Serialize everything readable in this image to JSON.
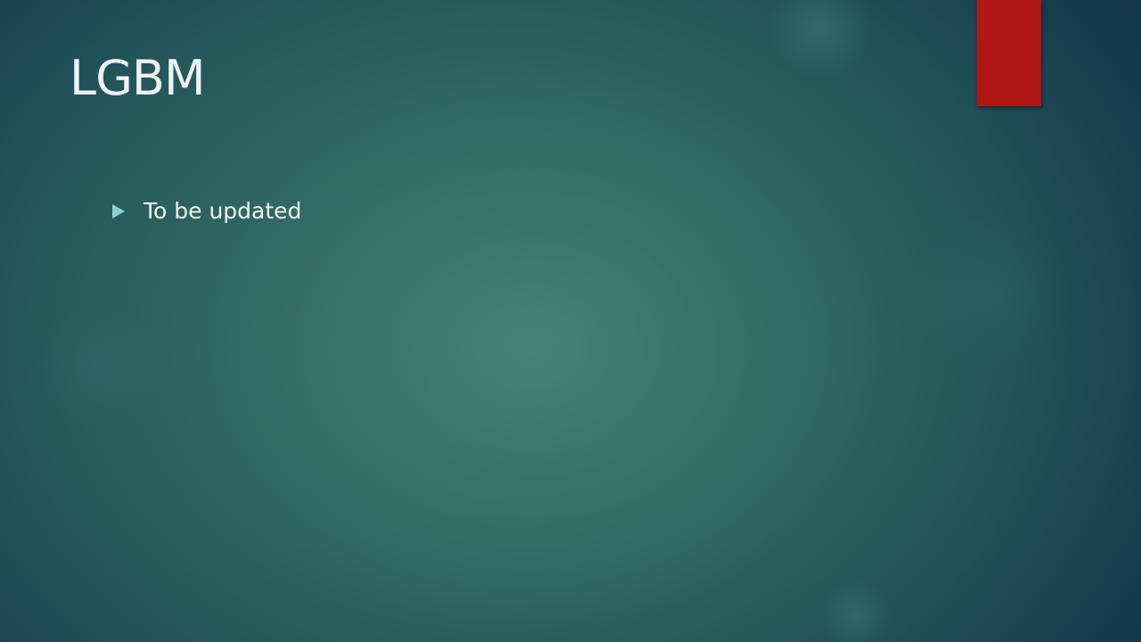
{
  "slide": {
    "title": "LGBM",
    "bullets": [
      {
        "text": "To be updated",
        "icon": "triangle-bullet-icon"
      }
    ]
  },
  "colors": {
    "accent": "#b01613",
    "bullet": "#8fd0d6",
    "text": "#f2f6f5",
    "background_center": "#3f7f72",
    "background_edge": "#123547"
  }
}
